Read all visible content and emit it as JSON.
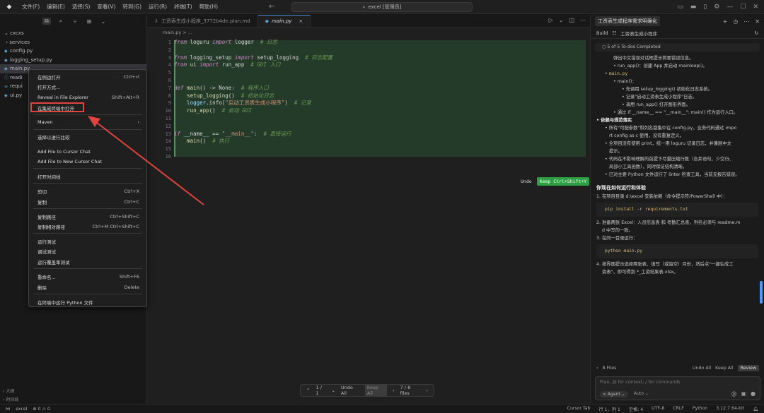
{
  "menubar": [
    "文件(F)",
    "编辑(E)",
    "选择(S)",
    "查看(V)",
    "转到(G)",
    "运行(R)",
    "终端(T)",
    "帮助(H)"
  ],
  "command_center": "excel [管理员]",
  "explorer": {
    "root": "cxcxs",
    "items": [
      "services",
      "config.py",
      "logging_setup.py",
      "main.py",
      "readi",
      "requi",
      "ui.py"
    ],
    "outline": [
      "大纲",
      "时间线"
    ]
  },
  "tabs": [
    {
      "label": "工资表生成小程序_3772b4de.plan.md"
    },
    {
      "label": "main.py",
      "close": "×"
    }
  ],
  "breadcrumb": "main.py > ...",
  "code_lines": [
    {
      "n": "1"
    },
    {
      "n": "2"
    },
    {
      "n": "3"
    },
    {
      "n": "4"
    },
    {
      "n": "5"
    },
    {
      "n": "6"
    },
    {
      "n": "7"
    },
    {
      "n": "8"
    },
    {
      "n": "9"
    },
    {
      "n": "10"
    },
    {
      "n": "11"
    },
    {
      "n": "12"
    },
    {
      "n": "13"
    },
    {
      "n": "14"
    },
    {
      "n": "15"
    },
    {
      "n": "16"
    }
  ],
  "code": {
    "l1a": "from",
    "l1b": " loguru ",
    "l1c": "import",
    "l1d": " logger  ",
    "l1e": "# 日志",
    "l3a": "from",
    "l3b": " logging_setup ",
    "l3c": "import",
    "l3d": " setup_logging  ",
    "l3e": "# 日志配置",
    "l4a": "from",
    "l4b": " ui ",
    "l4c": "import",
    "l4d": " run_app  ",
    "l4e": "# GUI 入口",
    "l7a": "def",
    "l7b": " main",
    "l7c": "() -> None:  ",
    "l7d": "# 程序入口",
    "l8a": "    setup_logging",
    "l8b": "()  ",
    "l8c": "# 初始化日志",
    "l9a": "    logger",
    "l9b": ".info(",
    "l9c": "\"启动工资表生成小程序\"",
    "l9d": ")  ",
    "l9e": "# 记录",
    "l10a": "    run_app",
    "l10b": "()  ",
    "l10c": "# 启动 GUI",
    "l13a": "if",
    "l13b": " __name__ == ",
    "l13c": "\"__main__\"",
    "l13d": ":  ",
    "l13e": "# 直接运行",
    "l14a": "    main",
    "l14b": "()  ",
    "l14c": "# 执行"
  },
  "diff_actions": {
    "undo": "Undo",
    "keep": "Keep Ctrl+Shift+Y"
  },
  "review_bar": {
    "pos": "1 / 1",
    "undo_all": "Undo All",
    "keep_all": "Keep All",
    "files": "7 / 8 files"
  },
  "context_menu": [
    {
      "label": "在侧边打开",
      "shortcut": "Ctrl+⏎"
    },
    {
      "label": "打开方式...",
      "shortcut": ""
    },
    {
      "label": "Reveal in File Explorer",
      "shortcut": "Shift+Alt+R"
    },
    {
      "label": "在集成终端中打开",
      "shortcut": ""
    },
    {
      "label": "Maven",
      "shortcut": "›"
    },
    {
      "label": "选择以进行比较",
      "shortcut": ""
    },
    {
      "label": "Add File to Cursor Chat",
      "shortcut": ""
    },
    {
      "label": "Add File to New Cursor Chat",
      "shortcut": ""
    },
    {
      "label": "打开时间线",
      "shortcut": ""
    },
    {
      "label": "剪切",
      "shortcut": "Ctrl+X"
    },
    {
      "label": "复制",
      "shortcut": "Ctrl+C"
    },
    {
      "label": "复制路径",
      "shortcut": "Ctrl+Shift+C"
    },
    {
      "label": "复制相对路径",
      "shortcut": "Ctrl+M Ctrl+Shift+C"
    },
    {
      "label": "运行测试",
      "shortcut": ""
    },
    {
      "label": "调试测试",
      "shortcut": ""
    },
    {
      "label": "运行覆盖率测试",
      "shortcut": ""
    },
    {
      "label": "重命名...",
      "shortcut": "Shift+F6"
    },
    {
      "label": "删除",
      "shortcut": "Delete"
    },
    {
      "label": "在终端中运行 Python 文件",
      "shortcut": ""
    }
  ],
  "panel": {
    "title": "工资表生成程序需求明确化",
    "build_label": "Build",
    "build_title": "工资表生成小程序",
    "todos": "5 of 5 To-dos Completed",
    "rows": [
      "弹出中文错误对话框提示简要错误信息。",
      "run_app()：创建 App 并启动 mainloop()。",
      "main.py",
      "main()：",
      "先调用 setup_logging() 初始化日志系统。",
      "记录\"启动工资表生成小程序\"日志。",
      "调用 run_app() 打开图形界面。",
      "通过 if __name__ == \"__main__\": main() 作为运行入口。",
      "依赖与规范落实",
      "所有\"可配参数\"和列名都集中在 config.py，业务代码通过 impo",
      "rt config as c 使用，没有重复定义。",
      "全项目没有使用 print，统一用 loguru 记录日志，并兼顾中文",
      "提示。",
      "代码在不影响理解的前提下尽量压缩行数（合并语句、少空行、",
      "局部小工具函数），同时保证结构清晰。",
      "已对主要 Python 文件运行了 linter 检查工具，当前无报告错误。"
    ],
    "how_to_run": "你现在如何运行和体验",
    "step1": "1. 在项目目录 d:\\excel 安装依赖（命令提示符/PowerShell 中）：",
    "cmd1": "pip install -r requirements.txt",
    "step2a": "2. 准备两张 Excel：人员信息表 和 考勤汇总表，列名必须与 readme.m",
    "step2b": "d 中写的一致。",
    "step3": "3. 在同一目录运行：",
    "cmd2": "python main.py",
    "step4a": "4. 按界面提示选择两张表、填写（或留空）月份，然后点\"一键生成工",
    "step4b": "资表\"，即可得到 *_工资结果表.xlsx。",
    "files": "8 Files",
    "undo_all": "Undo All",
    "keep_all": "Keep All",
    "review": "Review",
    "input_placeholder": "Plan, @ for context, / for commands",
    "agent": "Agent",
    "auto": "Auto"
  },
  "status": {
    "left": [
      "excel",
      "⊗ 0 ⚠ 0"
    ],
    "right": [
      "Cursor Tab",
      "行 1，列 1",
      "空格: 4",
      "UTF-8",
      "CRLF",
      "Python",
      "3.12.7 64-bit"
    ]
  }
}
